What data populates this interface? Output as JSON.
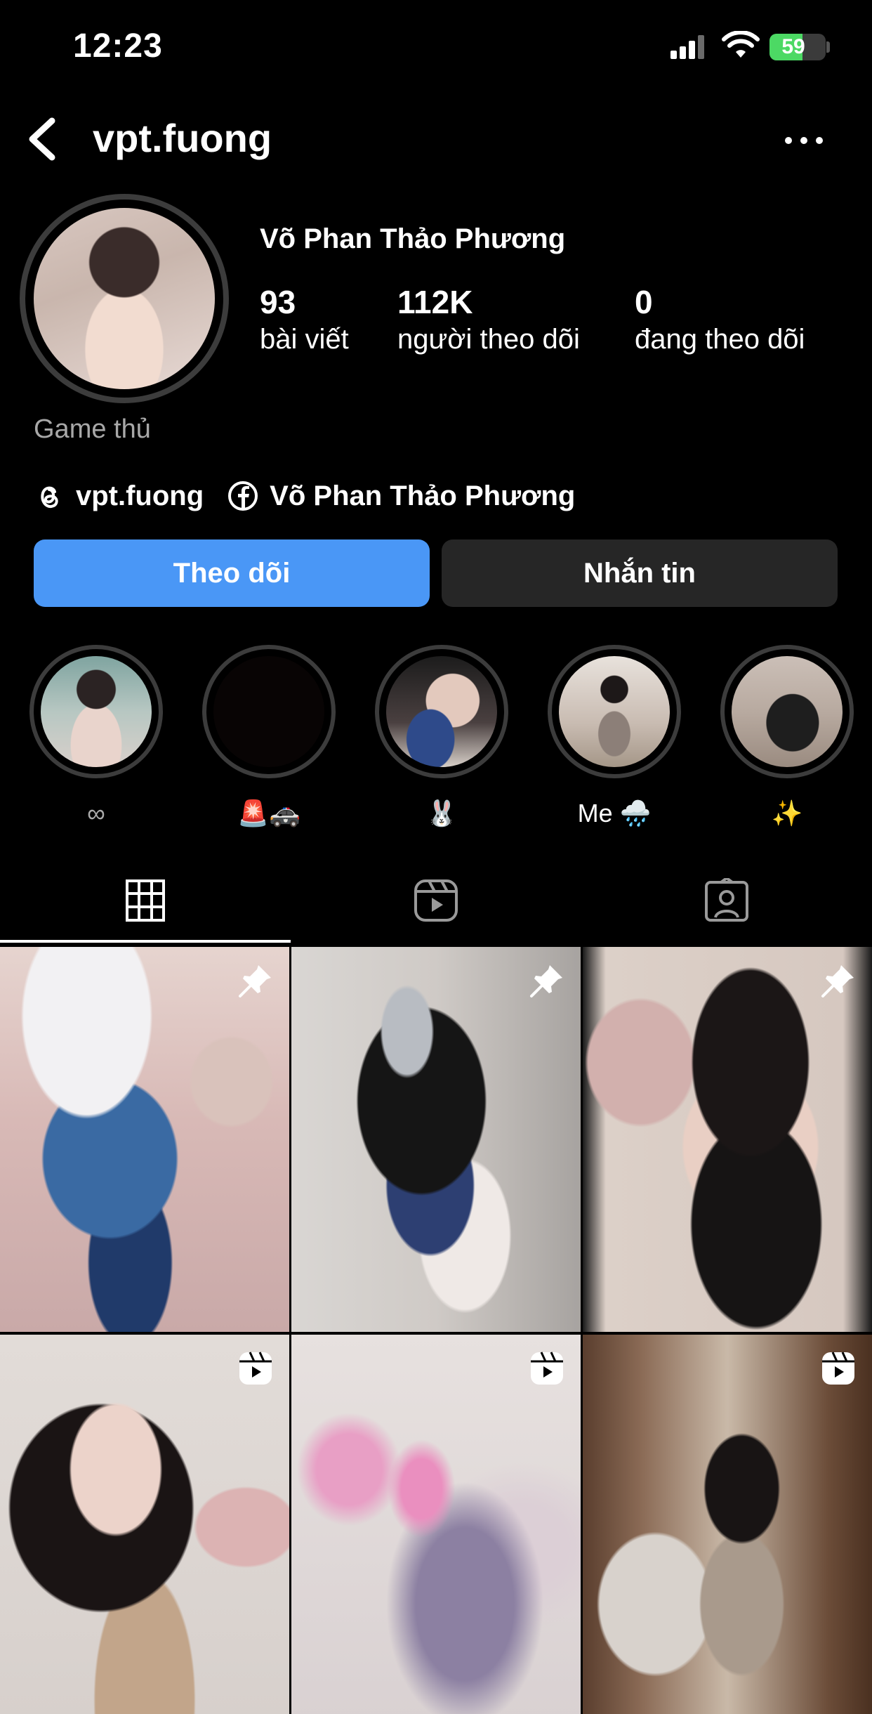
{
  "status_bar": {
    "time": "12:23",
    "battery_level": "59",
    "battery_fraction": 0.59,
    "signal_icon": "cellular-signal-icon",
    "wifi_icon": "wifi-icon",
    "charging": true
  },
  "header": {
    "username": "vpt.fuong",
    "back_icon": "chevron-left-icon",
    "more_icon": "more-horizontal-icon"
  },
  "profile": {
    "full_name": "Võ Phan Thảo Phương",
    "stats": [
      {
        "value": "93",
        "label": "bài viết"
      },
      {
        "value": "112K",
        "label": "người theo dõi"
      },
      {
        "value": "0",
        "label": "đang theo dõi"
      }
    ],
    "category": "Game thủ",
    "links": [
      {
        "icon": "threads-icon",
        "text": "vpt.fuong"
      },
      {
        "icon": "facebook-icon",
        "text": "Võ Phan Thảo Phương"
      }
    ]
  },
  "actions": {
    "follow_label": "Theo dõi",
    "message_label": "Nhắn tin"
  },
  "highlights": [
    {
      "label": "∞"
    },
    {
      "label": "🚨🚓"
    },
    {
      "label": "🐰"
    },
    {
      "label": "Me 🌧️"
    },
    {
      "label": "✨"
    }
  ],
  "tabs": [
    {
      "icon": "grid-icon",
      "active": true
    },
    {
      "icon": "reels-icon",
      "active": false
    },
    {
      "icon": "tagged-icon",
      "active": false
    }
  ],
  "posts": [
    {
      "badge": "pin-icon"
    },
    {
      "badge": "pin-icon"
    },
    {
      "badge": "pin-icon"
    },
    {
      "badge": "reel-icon"
    },
    {
      "badge": "reel-icon"
    },
    {
      "badge": "reel-icon"
    }
  ],
  "colors": {
    "background": "#000000",
    "follow_button": "#4a97f6",
    "message_button": "#262626",
    "muted_text": "#a8a8a8",
    "battery_green": "#4cd964"
  }
}
